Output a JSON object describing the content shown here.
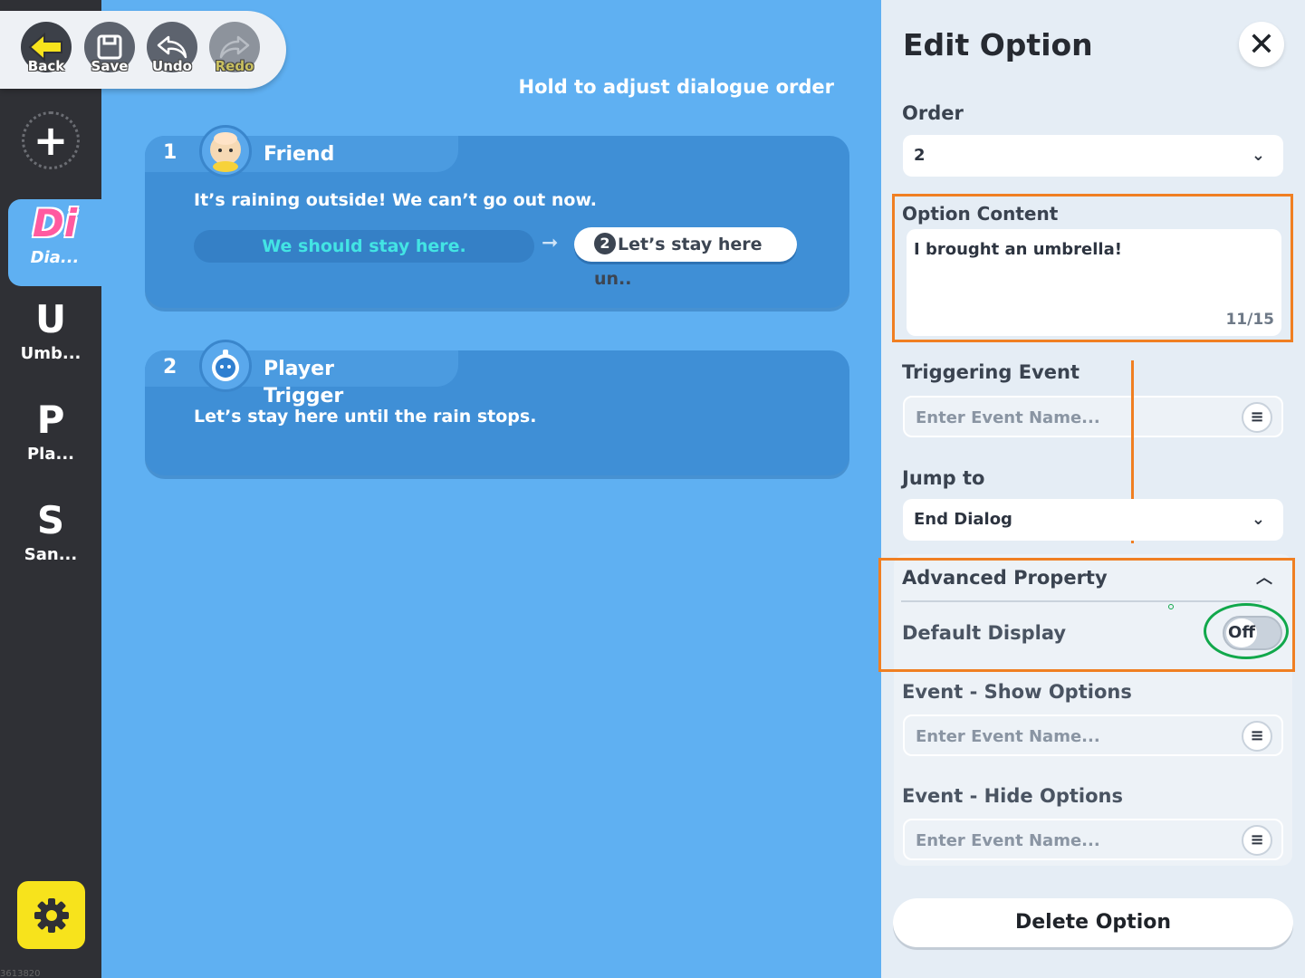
{
  "toolbar": {
    "back": "Back",
    "save": "Save",
    "undo": "Undo",
    "redo": "Redo"
  },
  "sidebar": {
    "items": [
      {
        "letter": "Di",
        "label": "Dia..."
      },
      {
        "letter": "U",
        "label": "Umb..."
      },
      {
        "letter": "P",
        "label": "Pla..."
      },
      {
        "letter": "S",
        "label": "San..."
      }
    ],
    "id_text": "3613820"
  },
  "hint": "Hold to adjust dialogue order",
  "dialogues": [
    {
      "number": "1",
      "speaker": "Friend",
      "text": "It’s raining outside! We can’t go out now.",
      "option_text": "We should stay here.",
      "next_badge": "2",
      "next_text": "Let’s stay here un.."
    },
    {
      "number": "2",
      "speaker": "Player",
      "speaker_sub": "Trigger",
      "text": "Let’s stay here until the rain stops."
    }
  ],
  "panel": {
    "title": "Edit Option",
    "order_label": "Order",
    "order_value": "2",
    "content_label": "Option Content",
    "content_value": "I brought an umbrella!",
    "content_counter": "11/15",
    "triggering_label": "Triggering Event",
    "triggering_placeholder": "Enter Event Name...",
    "jump_label": "Jump to",
    "jump_value": "End Dialog",
    "advanced_label": "Advanced Property",
    "default_display_label": "Default Display",
    "default_display_value": "Off",
    "show_label": "Event - Show Options",
    "show_placeholder": "Enter Event Name...",
    "hide_label": "Event - Hide Options",
    "hide_placeholder": "Enter Event Name...",
    "delete_label": "Delete Option"
  },
  "colors": {
    "canvas": "#5fb0f2",
    "card": "#3f8fd6",
    "sidebar": "#2f3035",
    "highlight_orange": "#f07f22",
    "highlight_green": "#11a84b",
    "settings_yellow": "#f7e31c"
  }
}
